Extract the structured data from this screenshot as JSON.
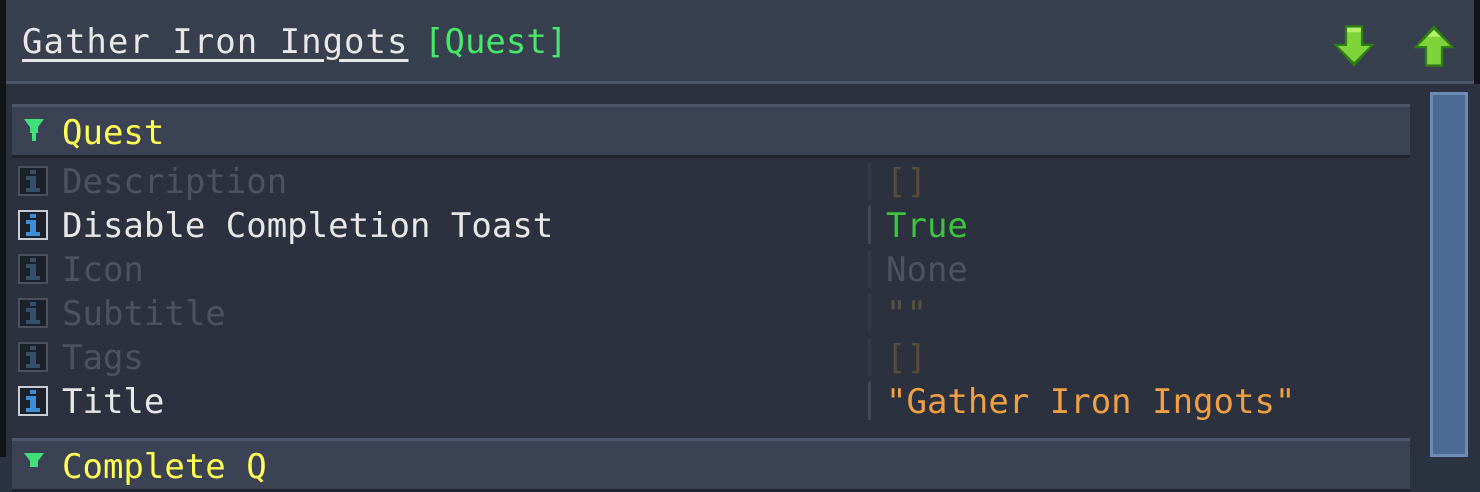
{
  "header": {
    "title": "Gather Iron Ingots",
    "tag": "[Quest]",
    "move_down_icon": "arrow-down-icon",
    "move_up_icon": "arrow-up-icon"
  },
  "section": {
    "label": "Quest",
    "next_label": "Complete Q"
  },
  "properties": [
    {
      "name": "Description",
      "value": "[]",
      "value_color": "#5a4a3a",
      "active": false
    },
    {
      "name": "Disable Completion Toast",
      "value": "True",
      "value_color": "#3dc43d",
      "active": true
    },
    {
      "name": "Icon",
      "value": "None",
      "value_color": "#4c5260",
      "active": false
    },
    {
      "name": "Subtitle",
      "value": "\"\"",
      "value_color": "#5a5040",
      "active": false
    },
    {
      "name": "Tags",
      "value": "[]",
      "value_color": "#5a4a3a",
      "active": false
    },
    {
      "name": "Title",
      "value": "\"Gather Iron Ingots\"",
      "value_color": "#f0a040",
      "active": true
    }
  ],
  "colors": {
    "accent_green": "#45e86a",
    "section_yellow": "#ffff55",
    "info_icon_active": "#3a8fd6",
    "info_icon_dim": "#34506a"
  }
}
